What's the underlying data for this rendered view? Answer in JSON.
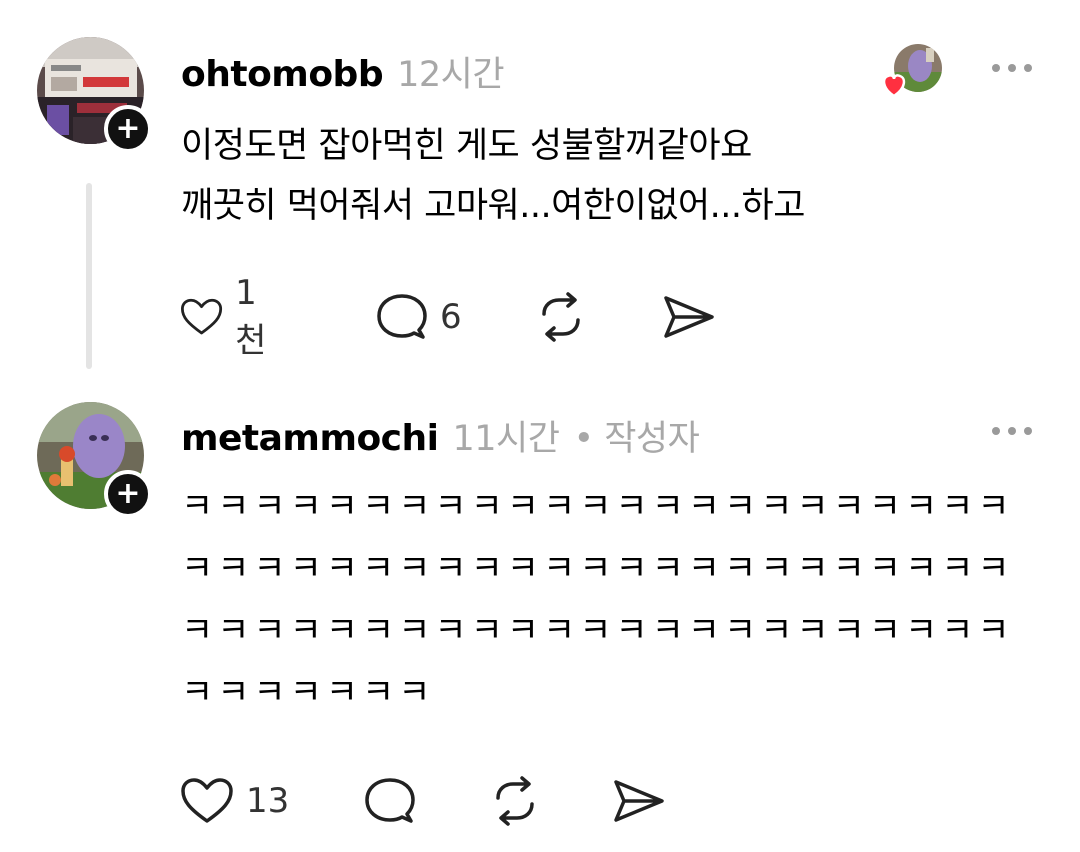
{
  "posts": [
    {
      "username": "ohtomobb",
      "time": "12시간",
      "text": "이정도면 잡아먹힌 게도 성불할꺼같아요\n깨끗히 먹어줘서 고마워...여한이없어...하고",
      "likes": "1천",
      "comments": "6",
      "avatar_icon": "storefront-photo",
      "liked_by_icon": "liker-avatar-with-heart"
    },
    {
      "username": "metammochi",
      "time": "11시간",
      "author_badge": "• 작성자",
      "text": "ㅋㅋㅋㅋㅋㅋㅋㅋㅋㅋㅋㅋㅋㅋㅋㅋㅋㅋㅋㅋㅋㅋㅋㅋㅋㅋㅋㅋㅋㅋㅋㅋㅋㅋㅋㅋㅋㅋㅋㅋㅋㅋㅋㅋㅋㅋㅋㅋㅋㅋㅋㅋㅋㅋㅋㅋㅋㅋㅋㅋㅋㅋㅋㅋㅋㅋㅋㅋㅋㅋㅋㅋㅋㅋㅋㅋ",
      "likes": "13",
      "avatar_icon": "purple-plush-photo"
    }
  ],
  "icons": {
    "like": "heart-outline-icon",
    "comment": "comment-bubble-icon",
    "repost": "repost-arrows-icon",
    "share": "send-icon",
    "follow": "plus-icon",
    "more": "more-dots-icon"
  },
  "colors": {
    "text": "#000000",
    "muted": "#a8a8a8",
    "heart": "#ff3040",
    "thread_line": "#e4e4e4"
  }
}
